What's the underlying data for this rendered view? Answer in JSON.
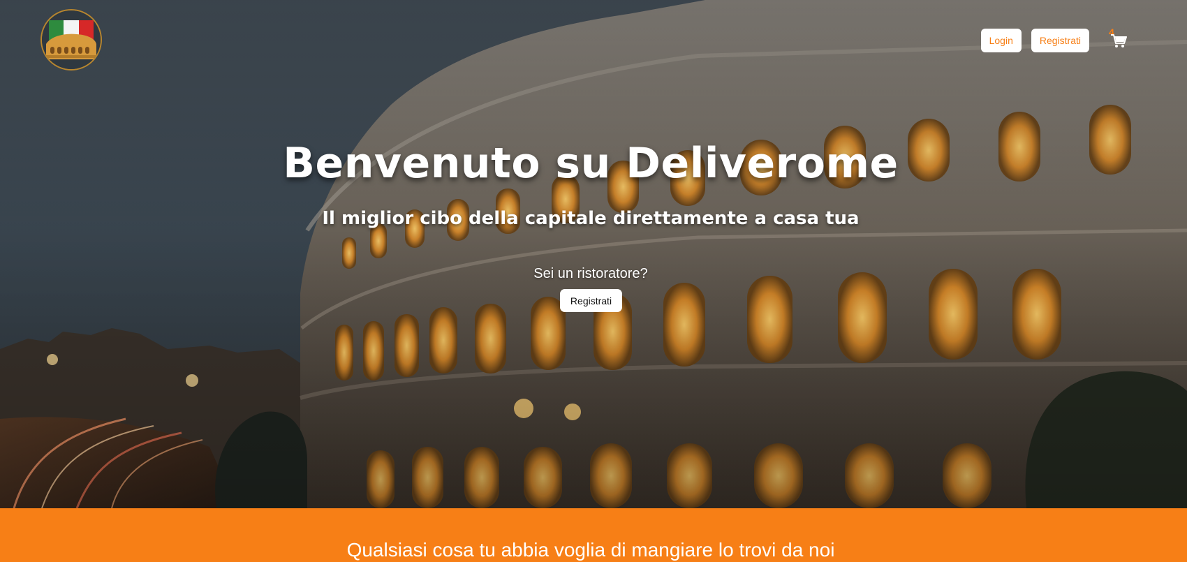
{
  "colors": {
    "accent": "#f77f16",
    "button_bg": "#ffffff",
    "headline_text": "#ffffff"
  },
  "header": {
    "logo_icon": "colosseum-italian-flag-logo",
    "login_label": "Login",
    "register_label": "Registrati",
    "cart_icon": "shopping-cart-icon",
    "cart_count": "4"
  },
  "hero": {
    "title": "Benvenuto su Deliverome",
    "subtitle": "Il miglior cibo della capitale direttamente a casa tua",
    "restaurateur_question": "Sei un ristoratore?",
    "restaurateur_cta": "Registrati"
  },
  "banner": {
    "text": "Qualsiasi cosa tu abbia voglia di mangiare lo trovi da noi"
  }
}
